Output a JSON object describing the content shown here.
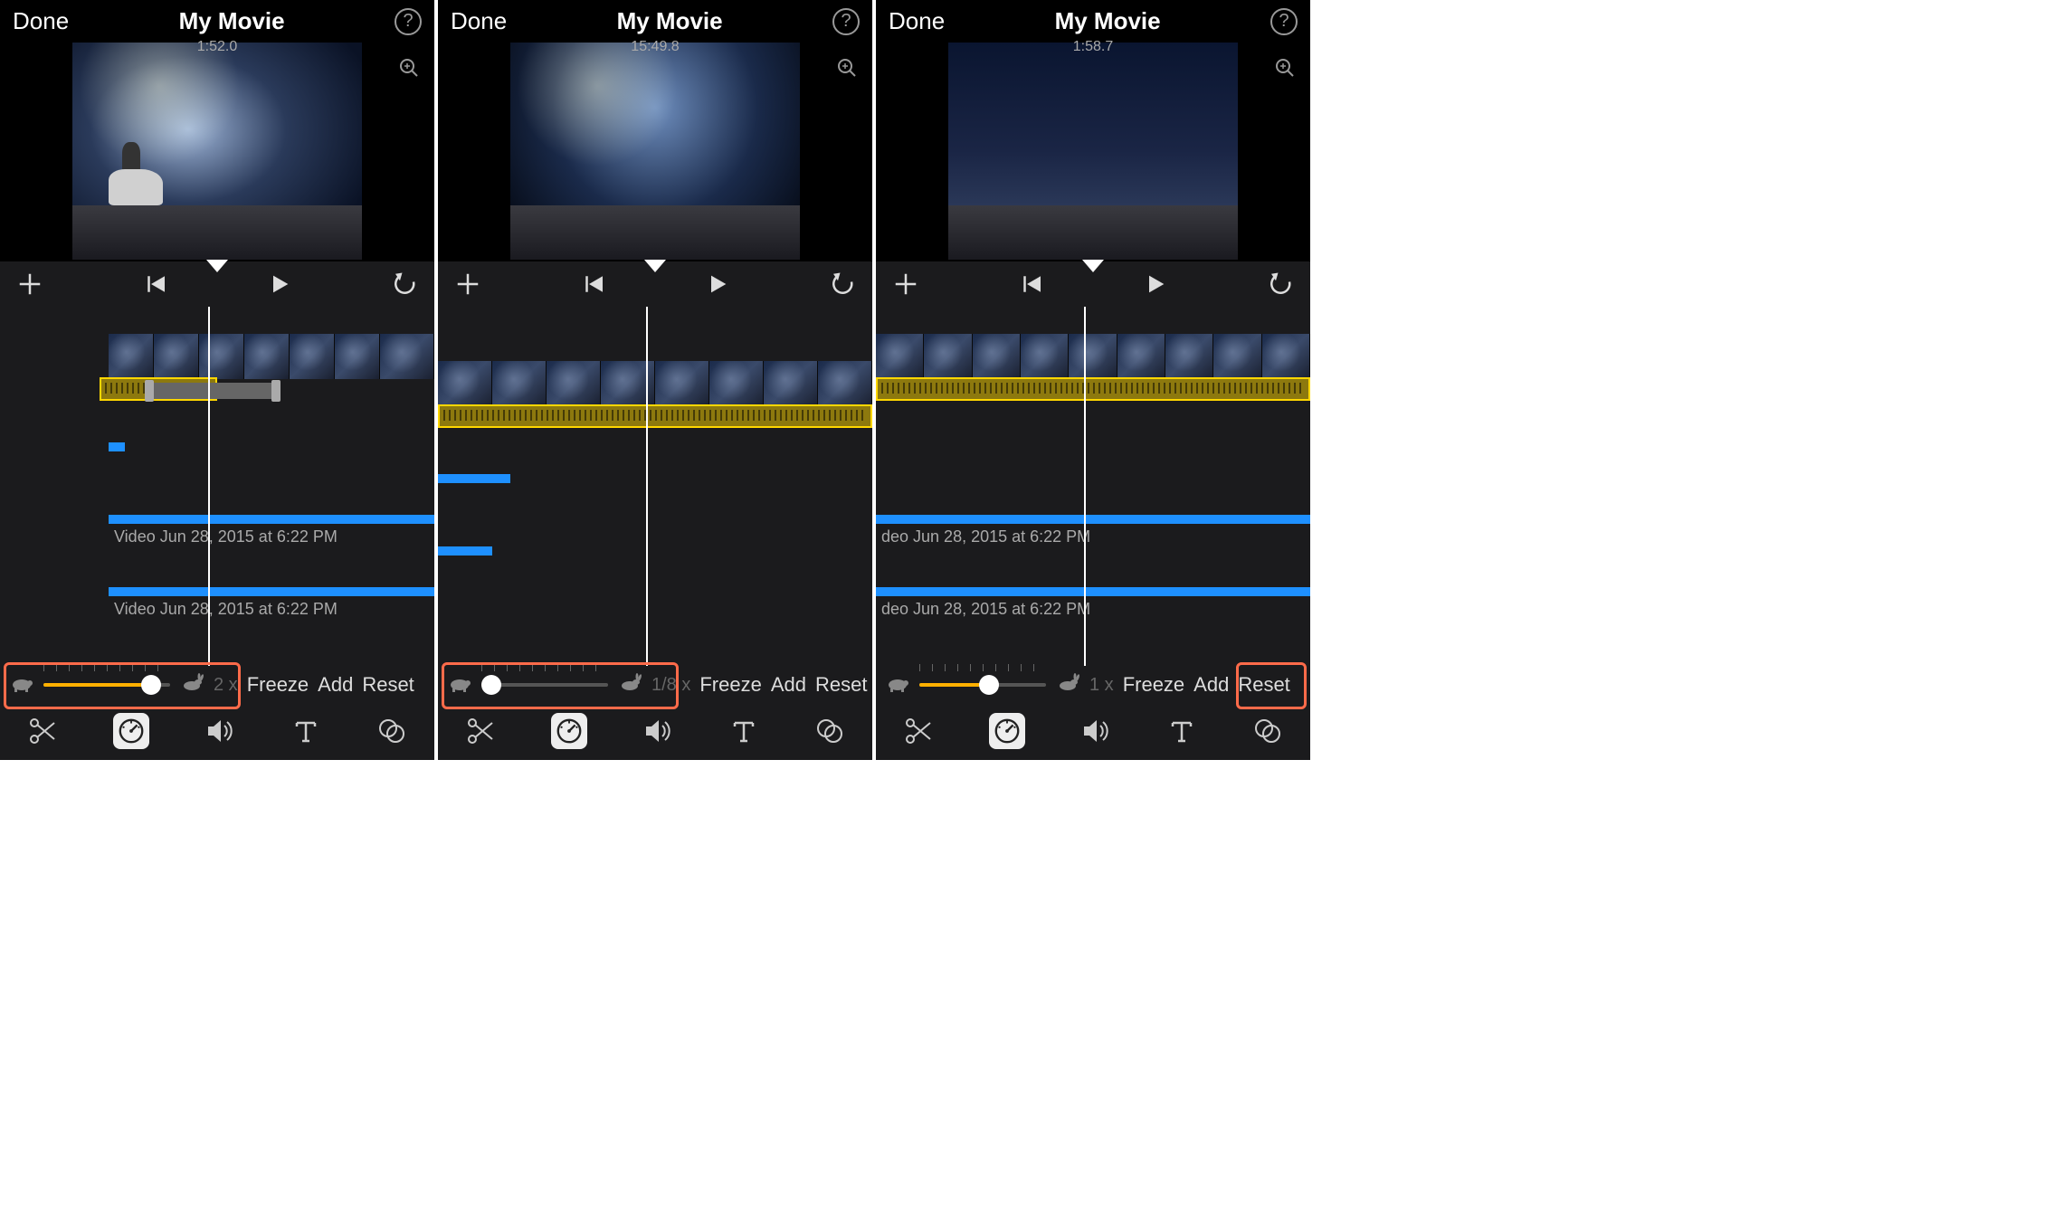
{
  "panels": [
    {
      "done": "Done",
      "title": "My Movie",
      "timecode": "1:52.0",
      "clip_labels": [
        "Video Jun 28, 2015 at 6:22 PM",
        "Video Jun 28, 2015 at 6:22 PM"
      ],
      "speed_label": "2 x",
      "freeze": "Freeze",
      "add": "Add",
      "reset": "Reset",
      "slider_pct": 85,
      "slider_width": 140,
      "playhead_pct": 48,
      "highlight": "slider"
    },
    {
      "done": "Done",
      "title": "My Movie",
      "timecode": "15:49.8",
      "clip_labels": [],
      "speed_label": "1/8 x",
      "freeze": "Freeze",
      "add": "Add",
      "reset": "Reset",
      "slider_pct": 8,
      "slider_width": 140,
      "playhead_pct": 48,
      "highlight": "slider"
    },
    {
      "done": "Done",
      "title": "My Movie",
      "timecode": "1:58.7",
      "clip_labels": [
        "deo Jun 28, 2015 at 6:22 PM",
        "deo Jun 28, 2015 at 6:22 PM"
      ],
      "speed_label": "1 x",
      "freeze": "Freeze",
      "add": "Add",
      "reset": "Reset",
      "slider_pct": 55,
      "slider_width": 140,
      "playhead_pct": 48,
      "highlight": "reset"
    }
  ]
}
